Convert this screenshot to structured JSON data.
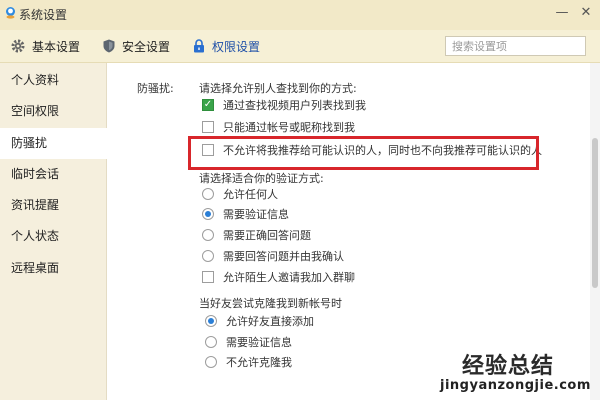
{
  "window": {
    "title": "系统设置",
    "min_glyph": "—",
    "close_glyph": "✕"
  },
  "top_tabs": [
    {
      "label": "基本设置",
      "icon": "gear-icon"
    },
    {
      "label": "安全设置",
      "icon": "shield-icon"
    },
    {
      "label": "权限设置",
      "icon": "lock-icon",
      "active": true
    }
  ],
  "search": {
    "placeholder": "搜索设置项"
  },
  "sidebar": {
    "items": [
      {
        "label": "个人资料"
      },
      {
        "label": "空间权限"
      },
      {
        "label": "防骚扰",
        "active": true
      },
      {
        "label": "临时会话"
      },
      {
        "label": "资讯提醒"
      },
      {
        "label": "个人状态"
      },
      {
        "label": "远程桌面"
      }
    ]
  },
  "content": {
    "section_label": "防骚扰:",
    "find_prompt": "请选择允许别人查找到你的方式:",
    "find_options": [
      {
        "label": "通过查找视频用户列表找到我",
        "checked": true
      },
      {
        "label": "只能通过帐号或昵称找到我",
        "checked": false
      },
      {
        "label": "不允许将我推荐给可能认识的人，同时也不向我推荐可能认识的人",
        "checked": false
      }
    ],
    "verify_prompt": "请选择适合你的验证方式:",
    "verify_options": [
      {
        "label": "允许任何人",
        "checked": false
      },
      {
        "label": "需要验证信息",
        "checked": true
      },
      {
        "label": "需要正确回答问题",
        "checked": false
      },
      {
        "label": "需要回答问题并由我确认",
        "checked": false
      }
    ],
    "group_invite": {
      "label": "允许陌生人邀请我加入群聊",
      "checked": false
    },
    "clone_prompt": "当好友尝试克隆我到新帐号时",
    "clone_options": [
      {
        "label": "允许好友直接添加",
        "checked": true
      },
      {
        "label": "需要验证信息",
        "checked": false
      },
      {
        "label": "不允许克隆我",
        "checked": false
      }
    ]
  },
  "watermark": {
    "text_cn": "经验总结",
    "url": "jingyanzongjie.com"
  },
  "colors": {
    "accent_blue": "#1e4fa8",
    "checkbox_green": "#3aa44a",
    "highlight_red": "#d8262b",
    "radio_blue": "#2b7fd6"
  }
}
